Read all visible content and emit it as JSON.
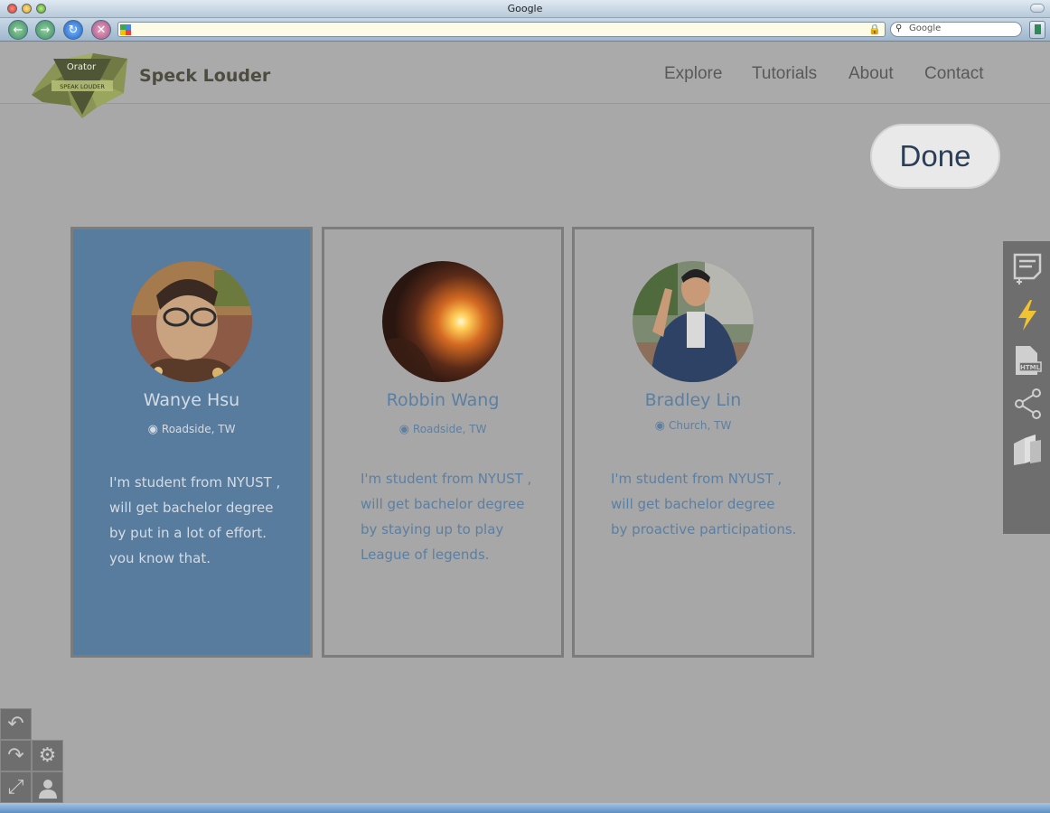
{
  "window": {
    "title": "Google"
  },
  "toolbar": {
    "search_placeholder": "Google"
  },
  "site": {
    "logo_top": "Orator",
    "logo_banner": "SPEAK LOUDER",
    "brand": "Speck Louder",
    "nav": [
      "Explore",
      "Tutorials",
      "About",
      "Contact"
    ]
  },
  "done_label": "Done",
  "cards": [
    {
      "name": "Wanye Hsu",
      "location": "Roadside, TW",
      "bio": [
        "I'm student from NYUST ,",
        "will get bachelor degree",
        "by put in a lot of effort.",
        "you know that."
      ],
      "selected": true
    },
    {
      "name": "Robbin Wang",
      "location": "Roadside, TW",
      "bio": [
        "I'm student from NYUST ,",
        "will get bachelor degree",
        "by staying up to play",
        "League of legends."
      ],
      "selected": false
    },
    {
      "name": "Bradley Lin",
      "location": "Church, TW",
      "bio": [
        "I'm student from NYUST ,",
        "will get bachelor degree",
        "by proactive participations."
      ],
      "selected": false
    }
  ],
  "tools": [
    "note-add-icon",
    "lightning-icon",
    "html-file-icon",
    "share-icon",
    "books-icon"
  ],
  "controls": [
    "undo-icon",
    "redo-icon",
    "settings-icon",
    "collapse-icon",
    "user-icon"
  ],
  "colors": {
    "card_selected": "#587c9d",
    "accent_text": "#5b7fa3",
    "panel": "#6e6e6e",
    "lightning": "#f1c232"
  }
}
